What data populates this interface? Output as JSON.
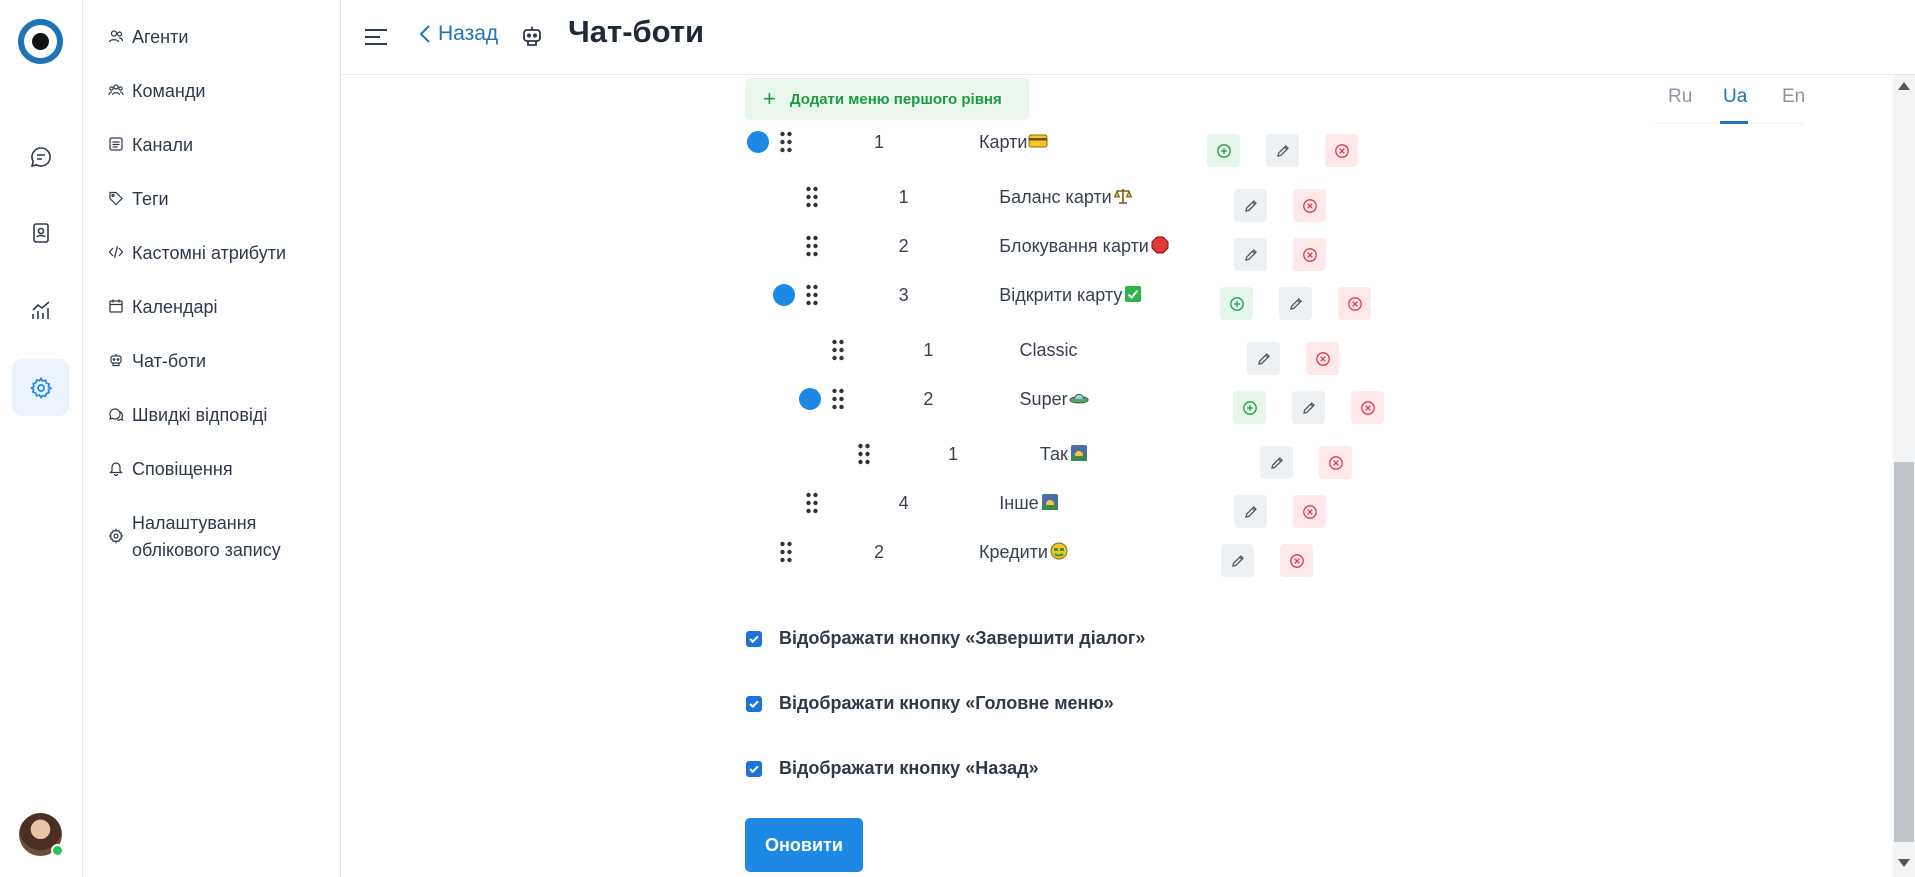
{
  "header": {
    "back_label": "Назад",
    "title": "Чат-боти"
  },
  "sidebar": {
    "items": [
      {
        "label": "Агенти",
        "icon": "agents-icon"
      },
      {
        "label": "Команди",
        "icon": "teams-icon"
      },
      {
        "label": "Канали",
        "icon": "channels-icon"
      },
      {
        "label": "Теги",
        "icon": "tag-icon"
      },
      {
        "label": "Кастомні атрибути",
        "icon": "code-icon"
      },
      {
        "label": "Календарі",
        "icon": "calendar-icon"
      },
      {
        "label": "Чат-боти",
        "icon": "bot-icon"
      },
      {
        "label": "Швидкі відповіді",
        "icon": "quick-replies-icon"
      },
      {
        "label": "Сповіщення",
        "icon": "bell-icon"
      },
      {
        "label": "Налаштування облікового запису",
        "icon": "settings-gear-icon"
      }
    ]
  },
  "main": {
    "add_menu_label": "Додати меню першого рівня",
    "languages": [
      "Ru",
      "Ua",
      "En"
    ],
    "active_language": "Ua",
    "menu_rows": [
      {
        "num": "1",
        "name": "Карти",
        "emoji": "credit-card-emoji",
        "level": 0,
        "has_children": true
      },
      {
        "num": "1",
        "name": "Баланс карти",
        "emoji": "scales-emoji",
        "level": 1,
        "has_children": false
      },
      {
        "num": "2",
        "name": "Блокування карти",
        "emoji": "stop-sign-emoji",
        "level": 1,
        "has_children": false
      },
      {
        "num": "3",
        "name": "Відкрити карту",
        "emoji": "check-mark-emoji",
        "level": 1,
        "has_children": true
      },
      {
        "num": "1",
        "name": "Classic",
        "emoji": "",
        "level": 2,
        "has_children": false
      },
      {
        "num": "2",
        "name": "Super",
        "emoji": "ufo-emoji",
        "level": 2,
        "has_children": true
      },
      {
        "num": "1",
        "name": "Так",
        "emoji": "sunrise-emoji",
        "level": 3,
        "has_children": false
      },
      {
        "num": "4",
        "name": "Інше",
        "emoji": "sunrise-emoji",
        "level": 1,
        "has_children": false
      },
      {
        "num": "2",
        "name": "Кредити",
        "emoji": "money-face-emoji",
        "level": 0,
        "has_children": false
      }
    ],
    "checkboxes": [
      {
        "label": "Відображати кнопку «Завершити діалог»",
        "checked": true
      },
      {
        "label": "Відображати кнопку «Головне меню»",
        "checked": true
      },
      {
        "label": "Відображати кнопку «Назад»",
        "checked": true
      }
    ],
    "update_label": "Оновити"
  },
  "colors": {
    "accent": "#1e88e5",
    "link": "#1f73b7",
    "success": "#1e9a44",
    "danger": "#e0364f"
  }
}
